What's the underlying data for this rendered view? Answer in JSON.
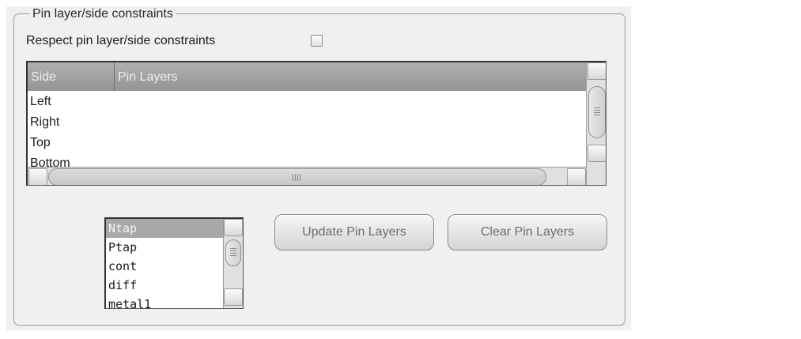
{
  "group": {
    "title": "Pin layer/side constraints",
    "respect_label": "Respect pin layer/side constraints",
    "respect_checked": false
  },
  "table": {
    "columns": [
      "Side",
      "Pin Layers"
    ],
    "rows": [
      {
        "side": "Left",
        "pin_layers": ""
      },
      {
        "side": "Right",
        "pin_layers": ""
      },
      {
        "side": "Top",
        "pin_layers": ""
      },
      {
        "side": "Bottom",
        "pin_layers": ""
      }
    ]
  },
  "layer_list": {
    "items": [
      "Ntap",
      "Ptap",
      "cont",
      "diff",
      "metal1"
    ],
    "selected": "Ntap"
  },
  "buttons": {
    "update": "Update Pin Layers",
    "clear": "Clear Pin Layers"
  },
  "colors": {
    "header_bg": "#a0a0a0",
    "selection_bg": "#a8a8a8",
    "panel_bg": "#f0f0f0"
  }
}
